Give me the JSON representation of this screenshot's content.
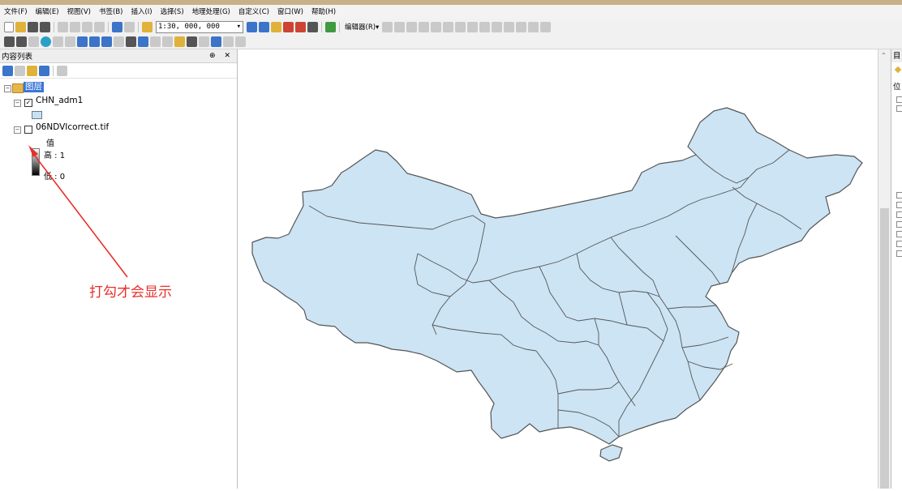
{
  "menubar": {
    "items": [
      "文件(F)",
      "编辑(E)",
      "视图(V)",
      "书签(B)",
      "插入(I)",
      "选择(S)",
      "地理处理(G)",
      "自定义(C)",
      "窗口(W)",
      "帮助(H)"
    ]
  },
  "toolbar": {
    "scale_value": "1:30, 000, 000",
    "editor_label": "编辑器(R)▾"
  },
  "toc": {
    "title": "内容列表",
    "controls": "⊕ ✕",
    "layers_group": "图层",
    "layers": [
      {
        "name": "CHN_adm1",
        "checked": true
      },
      {
        "name": "06NDVIcorrect.tif",
        "checked": false
      }
    ],
    "legend": {
      "heading": "值",
      "high": "高 : 1",
      "low": "低 : 0"
    }
  },
  "annotation": "打勾才会显示",
  "map": {
    "fill_color": "#cce4f4",
    "stroke_color": "#555555"
  },
  "right_panel": {
    "title": "目",
    "label": "位"
  }
}
